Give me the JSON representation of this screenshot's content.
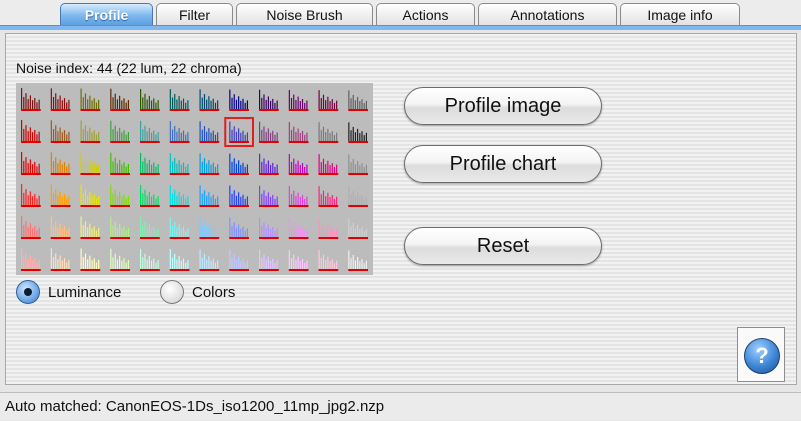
{
  "tabs": [
    {
      "label": "Profile",
      "active": true
    },
    {
      "label": "Filter",
      "active": false
    },
    {
      "label": "Noise Brush",
      "active": false
    },
    {
      "label": "Actions",
      "active": false
    },
    {
      "label": "Annotations",
      "active": false
    },
    {
      "label": "Image info",
      "active": false
    }
  ],
  "profile": {
    "noise_index": "Noise index:  44 (22 lum, 22 chroma)",
    "radio_luminance": "Luminance",
    "radio_colors": "Colors",
    "selected_mode": "Luminance",
    "buttons": {
      "profile_image": "Profile image",
      "profile_chart": "Profile chart",
      "reset": "Reset"
    },
    "help_label": "?"
  },
  "noise_grid": {
    "rows": 6,
    "cols": 12,
    "highlight": {
      "row": 1,
      "col": 7,
      "color": "#e02020"
    },
    "row_colors": [
      [
        "#7a1010",
        "#8a0c0c",
        "#6e6e00",
        "#5a2a00",
        "#2a5a00",
        "#005a5a",
        "#004a6e",
        "#00008a",
        "#3a0060",
        "#6a006a",
        "#700040",
        "#606060"
      ],
      [
        "#cc0000",
        "#9a5a20",
        "#a0a040",
        "#40a040",
        "#40a0a0",
        "#4070c0",
        "#2050c0",
        "#4040c0",
        "#804080",
        "#a04080",
        "#7a7a7a",
        "#202020"
      ],
      [
        "#e00000",
        "#e08000",
        "#d0d000",
        "#40c000",
        "#00c060",
        "#00c0c0",
        "#00a0e0",
        "#0040e0",
        "#6020e0",
        "#c000c0",
        "#e00080",
        "#909090"
      ],
      [
        "#ff2020",
        "#ff9f00",
        "#e8e800",
        "#80e000",
        "#00e060",
        "#00e0e0",
        "#20a0ff",
        "#2040ff",
        "#8040ff",
        "#e040e0",
        "#ff2080",
        "#b0b0b0"
      ],
      [
        "#ff7070",
        "#ffc080",
        "#f0f080",
        "#b0f080",
        "#80f0b0",
        "#80f0f0",
        "#80c8ff",
        "#8090ff",
        "#b090ff",
        "#f090f0",
        "#ff90c0",
        "#d0d0d0"
      ],
      [
        "#ffb0b0",
        "#ffe0c0",
        "#ffffc0",
        "#e0ffc0",
        "#c0ffe0",
        "#c0ffff",
        "#c0e8ff",
        "#c0c8ff",
        "#e0c8ff",
        "#ffc8ff",
        "#ffc8e0",
        "#f0f0f0"
      ]
    ],
    "bar_heights": [
      0.95,
      0.55,
      0.72,
      0.45,
      0.62,
      0.4,
      0.5,
      0.3,
      0.42
    ]
  },
  "status_text": "Auto matched: CanonEOS-1Ds_iso1200_11mp_jpg2.nzp"
}
